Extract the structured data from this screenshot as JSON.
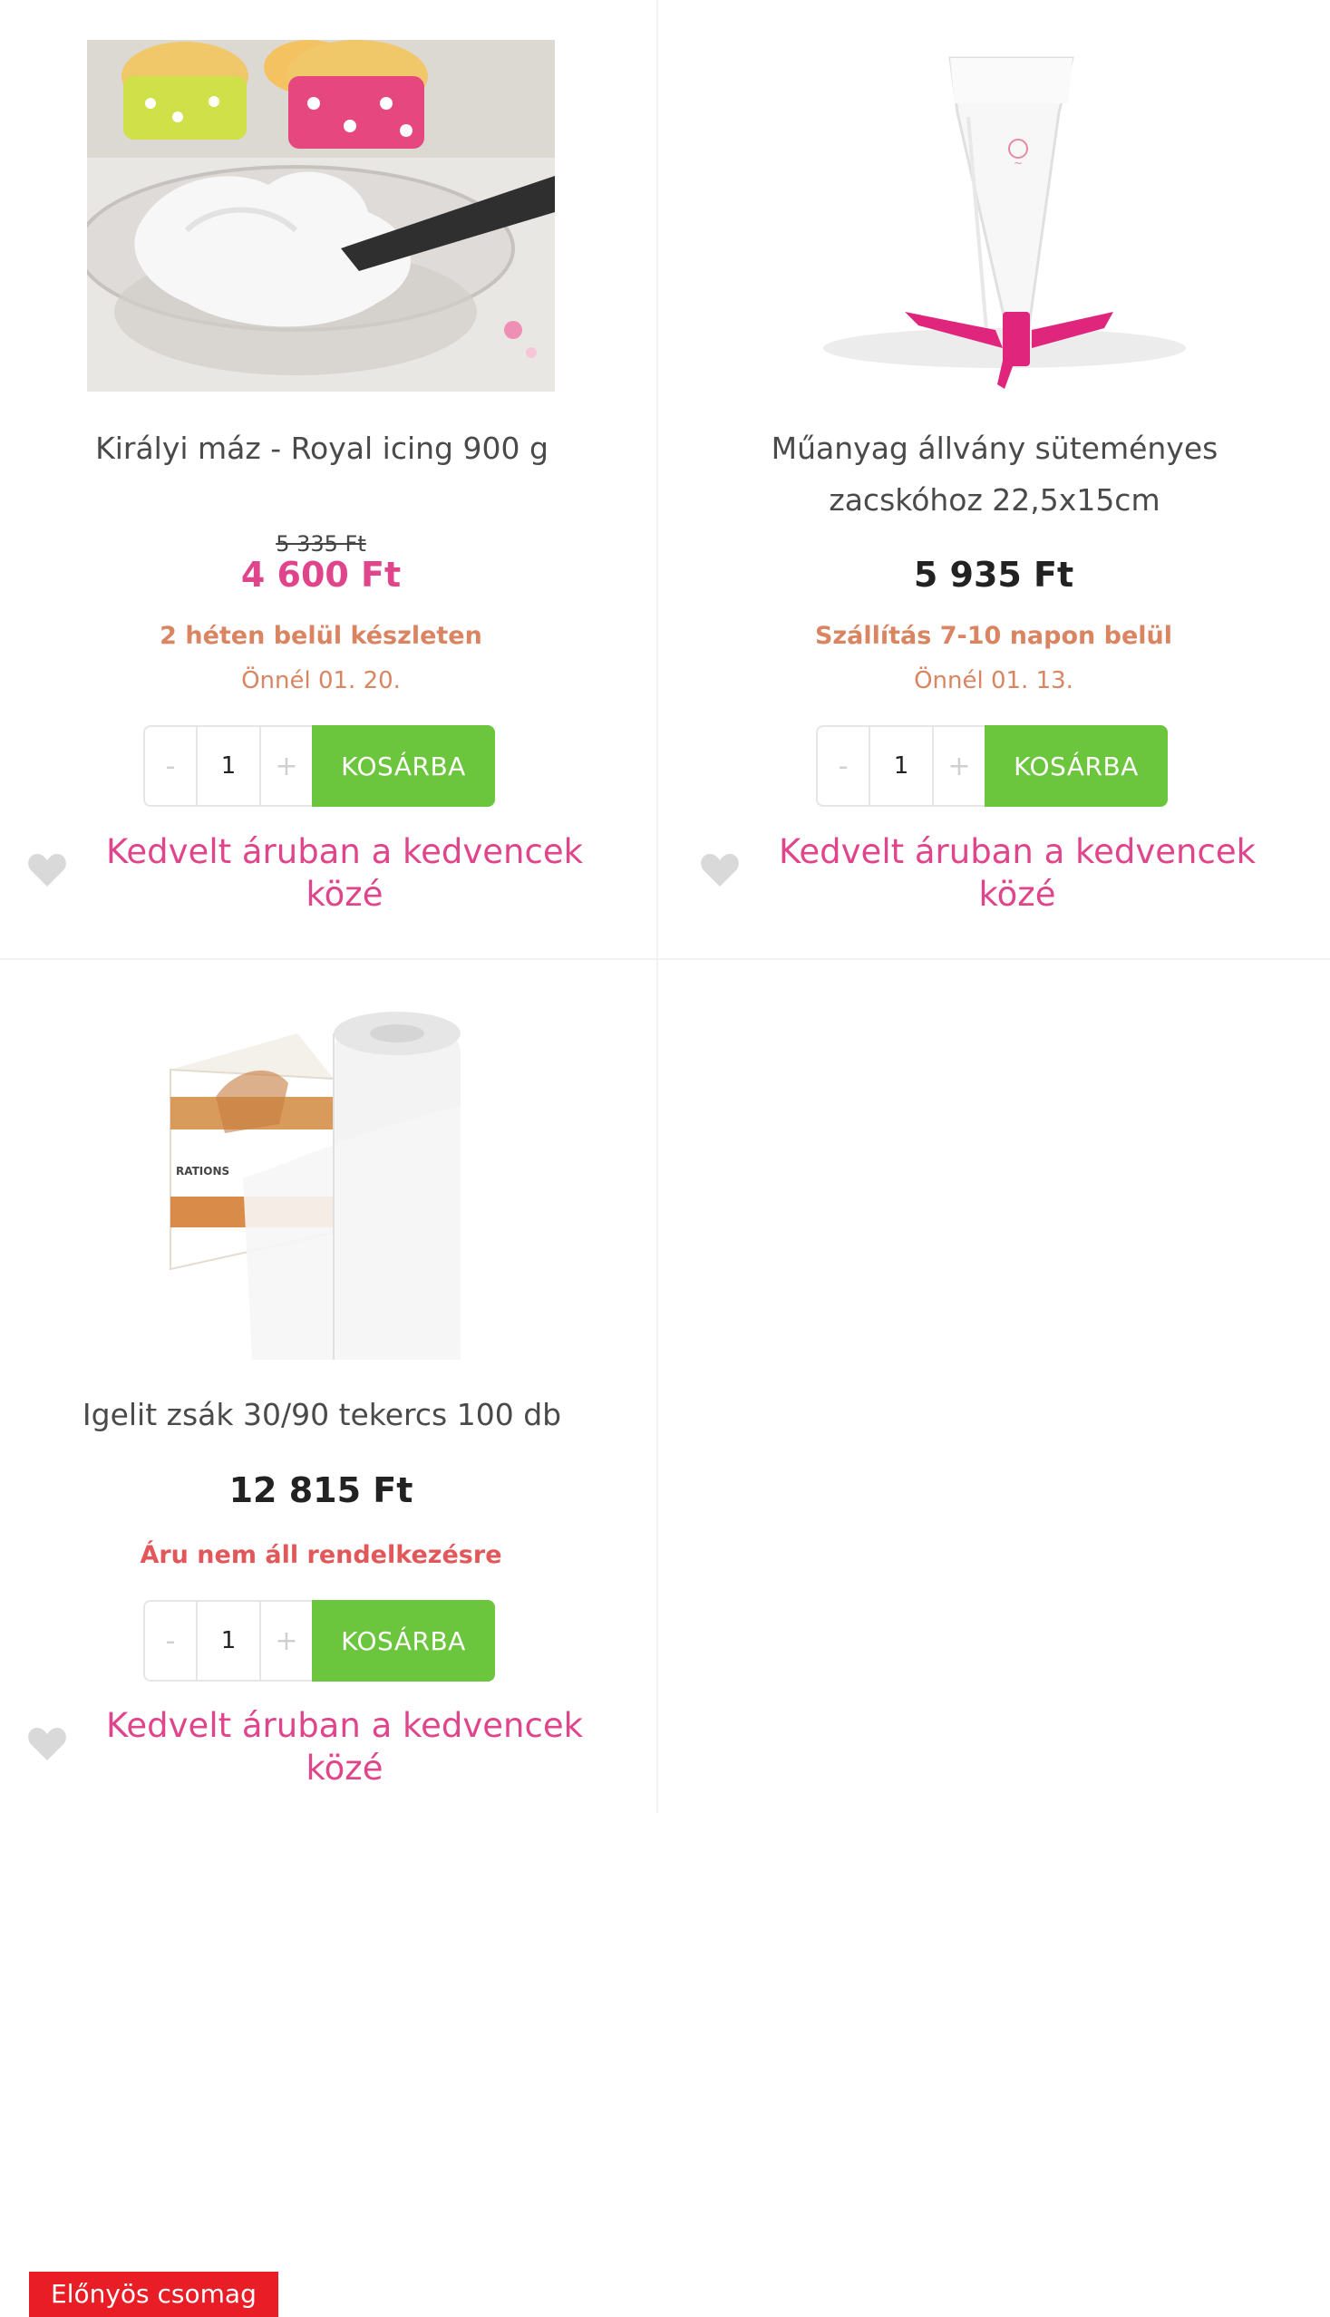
{
  "products": [
    {
      "title": "Királyi máz - Royal icing 900 g",
      "old_price": "5 335 Ft",
      "price": "4 600 Ft",
      "stock": "2 héten belül készleten",
      "delivery": "Önnél 01. 20.",
      "qty": "1",
      "qty_minus": "-",
      "qty_plus": "+",
      "cart_label": "KOSÁRBA",
      "fav_label": "Kedvelt áruban a kedvencek közé"
    },
    {
      "title": "Műanyag állvány süteményes zacskóhoz 22,5x15cm",
      "price": "5 935 Ft",
      "stock": "Szállítás 7-10 napon belül",
      "delivery": "Önnél 01. 13.",
      "qty": "1",
      "qty_minus": "-",
      "qty_plus": "+",
      "cart_label": "KOSÁRBA",
      "fav_label": "Kedvelt áruban a kedvencek közé"
    },
    {
      "badge": "Előnyös csomag",
      "title": "Igelit zsák 30/90 tekercs 100 db",
      "price": "12 815 Ft",
      "stock": "Áru nem áll rendelkezésre",
      "qty": "1",
      "qty_minus": "-",
      "qty_plus": "+",
      "cart_label": "KOSÁRBA",
      "fav_label": "Kedvelt áruban a kedvencek közé"
    }
  ],
  "colors": {
    "accent_pink": "#e0458c",
    "cart_green": "#6cc63d",
    "stock_orange": "#d98562",
    "unavailable_red": "#e2585a",
    "badge_red": "#e81d25"
  },
  "icons": {
    "favorite": "heart-icon"
  }
}
